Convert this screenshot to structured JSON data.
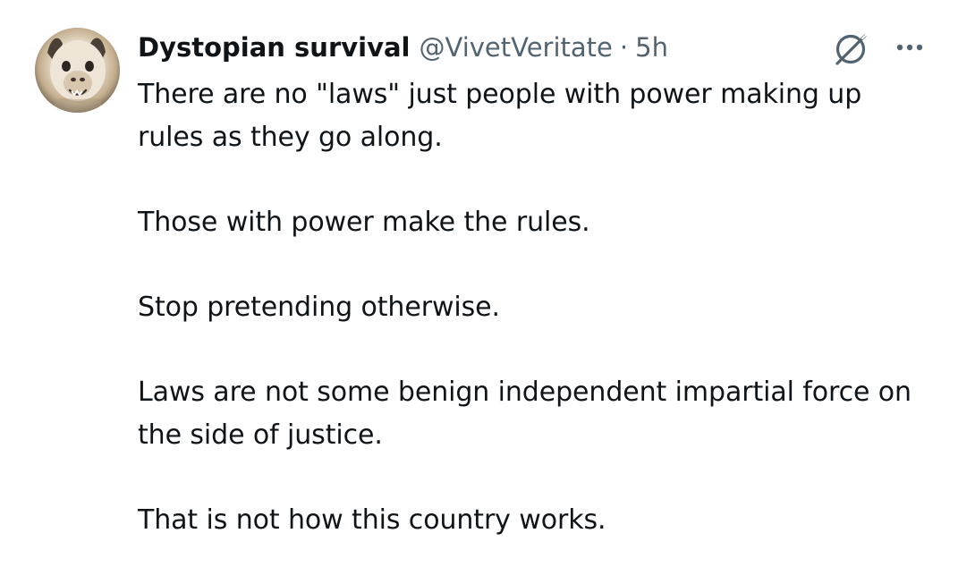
{
  "tweet": {
    "author": {
      "display_name": "Dystopian survival",
      "handle": "@VivetVeritate",
      "avatar_icon": "alpaca-avatar"
    },
    "separator": "·",
    "timestamp": "5h",
    "grok_icon": "grok-slash-icon",
    "more_icon": "more-options-icon",
    "paragraphs": [
      "There are no \"laws\" just people with power making up rules as they go along.",
      "Those with power make the rules.",
      "Stop pretending otherwise.",
      "Laws are not some benign independent impartial force on the side of justice.",
      "That is not how this country works."
    ]
  },
  "colors": {
    "text_primary": "#0f1419",
    "text_secondary": "#536471",
    "background": "#ffffff"
  }
}
